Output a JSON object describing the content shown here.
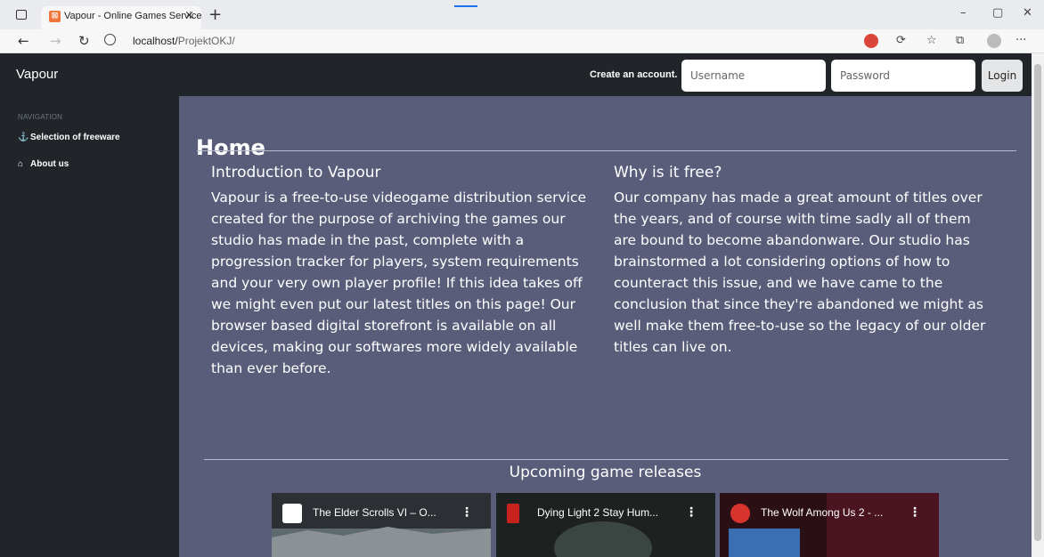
{
  "browser": {
    "tab_title": "Vapour - Online Games Service",
    "tab_close": "×",
    "new_tab": "+",
    "url_host": "localhost/",
    "url_path": "ProjektOKJ/",
    "minimize": "–",
    "maximize": "▢",
    "close": "✕",
    "back": "←",
    "forward": "→",
    "reload": "↻",
    "menu": "···"
  },
  "navbar": {
    "brand": "Vapour",
    "create_account": "Create an account.",
    "username_placeholder": "Username",
    "password_placeholder": "Password",
    "login_label": "Login"
  },
  "sidebar": {
    "heading": "NAVIGATION",
    "items": [
      {
        "label": "Selection of freeware",
        "icon": "anchor-icon"
      },
      {
        "label": "About us",
        "icon": "mouse-icon"
      }
    ]
  },
  "main": {
    "title": "Home",
    "intro_heading": "Introduction to Vapour",
    "intro_text": "Vapour is a free-to-use videogame distribution service created for the purpose of archiving the games our studio has made in the past, complete with a progression tracker for players, system requirements and your very own player profile! If this idea takes off we might even put our latest titles on this page! Our browser based digital storefront is available on all devices, making our softwares more widely available than ever before.",
    "why_heading": "Why is it free?",
    "why_text": "Our company has made a great amount of titles over the years, and of course with time sadly all of them are bound to become abandonware. Our studio has brainstormed a lot considering options of how to counteract this issue, and we have came to the conclusion that since they're abandoned we might as well make them free-to-use so the legacy of our older titles can live on.",
    "upcoming_heading": "Upcoming game releases",
    "videos": [
      {
        "title": "The Elder Scrolls VI – O..."
      },
      {
        "title": "Dying Light 2 Stay Hum..."
      },
      {
        "title": "The Wolf Among Us 2 - ..."
      }
    ]
  },
  "colors": {
    "navbar_bg": "#212529",
    "main_bg": "#5a5d7a"
  }
}
